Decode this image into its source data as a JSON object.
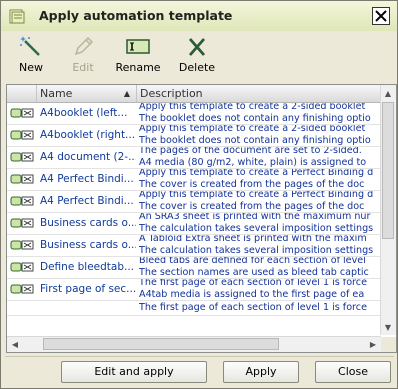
{
  "window": {
    "title": "Apply automation template"
  },
  "toolbar": {
    "new_label": "New",
    "edit_label": "Edit",
    "rename_label": "Rename",
    "delete_label": "Delete"
  },
  "table": {
    "columns": [
      "Name",
      "Description"
    ],
    "sort_column": "Name",
    "rows": [
      {
        "name": "A4booklet (left...",
        "desc1": "Apply this template to create a 2-sided booklet",
        "desc2": "The booklet does not contain any finishing optio"
      },
      {
        "name": "A4booklet (right...",
        "desc1": "Apply this template to create a 2-sided booklet",
        "desc2": "The booklet does not contain any finishing optio"
      },
      {
        "name": "A4 document (2-...",
        "desc1": "The pages of the document are set to 2-sided.",
        "desc2": "A4 media (80 g/m2, white, plain) is assigned to"
      },
      {
        "name": "A4 Perfect Bindi...",
        "desc1": "Apply this template to create a Perfect Binding d",
        "desc2": "The cover is created from the pages of the doc"
      },
      {
        "name": "A4 Perfect Bindi...",
        "desc1": "Apply this template to create a Perfect Binding d",
        "desc2": "The cover is created from the pages of the doc"
      },
      {
        "name": "Business cards o...",
        "desc1": "An SRA3 sheet is printed with the maximum nur",
        "desc2": "The calculation takes several imposition settings"
      },
      {
        "name": "Business cards o...",
        "desc1": "A Tabloid Extra sheet is printed with the maxim",
        "desc2": "The calculation takes several imposition settings"
      },
      {
        "name": "Define bleedtab...",
        "desc1": "Bleed tabs are defined for each section of level",
        "desc2": "The section names are used as bleed tab captic"
      },
      {
        "name": "First page of sec...",
        "desc1": "The first page of each section of level 1 is force",
        "desc2": "A4tab media is assigned to the first page of ea"
      },
      {
        "name": "",
        "desc1": "The first page of each section of level 1 is force",
        "desc2": ""
      }
    ]
  },
  "buttons": {
    "edit_apply": "Edit and apply",
    "apply": "Apply",
    "close": "Close"
  },
  "colors": {
    "title_bg": "#e6ecc2",
    "link_text": "#13329a",
    "window_bg": "#ece9d8"
  }
}
